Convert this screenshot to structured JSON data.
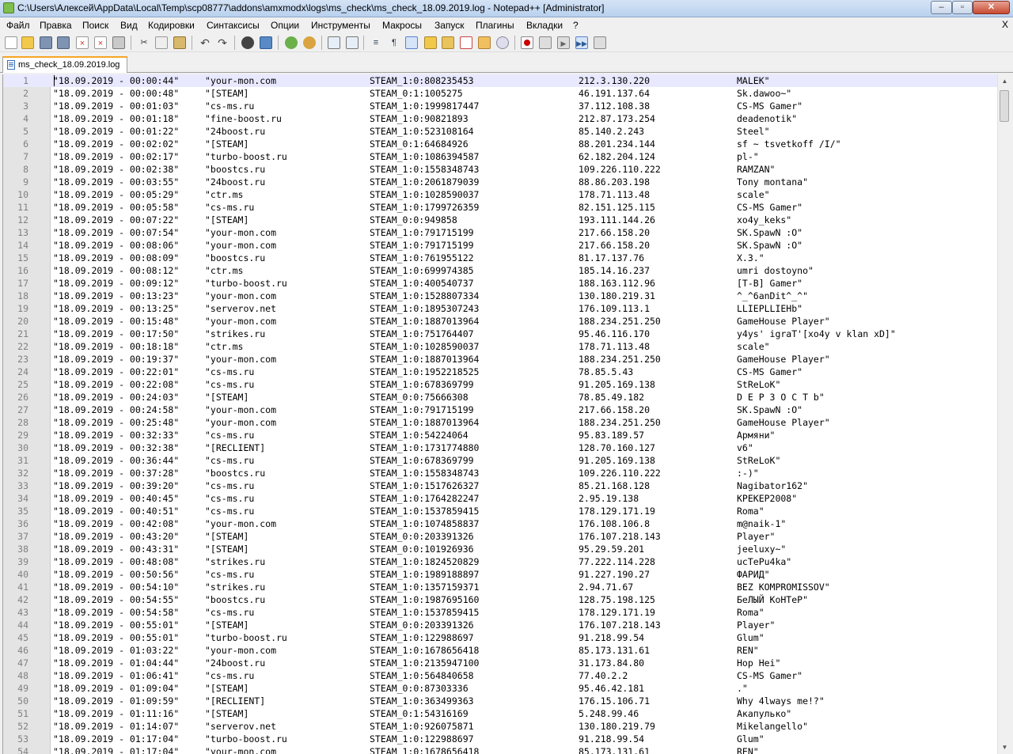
{
  "window": {
    "title": "C:\\Users\\Алексей\\AppData\\Local\\Temp\\scp08777\\addons\\amxmodx\\logs\\ms_check\\ms_check_18.09.2019.log - Notepad++ [Administrator]",
    "minimize_label": "–",
    "maximize_label": "▫",
    "close_label": "✕"
  },
  "menu": {
    "items": [
      "Файл",
      "Правка",
      "Поиск",
      "Вид",
      "Кодировки",
      "Синтаксисы",
      "Опции",
      "Инструменты",
      "Макросы",
      "Запуск",
      "Плагины",
      "Вкладки",
      "?"
    ],
    "close_doc_label": "X"
  },
  "toolbar": {
    "icons": [
      "new-file-icon",
      "open-file-icon",
      "save-icon",
      "save-all-icon",
      "close-icon",
      "close-all-icon",
      "print-icon",
      "cut-icon",
      "copy-icon",
      "paste-icon",
      "undo-icon",
      "redo-icon",
      "find-icon",
      "replace-icon",
      "zoom-in-icon",
      "zoom-out-icon",
      "sync-vertical-icon",
      "sync-horizontal-icon",
      "word-wrap-icon",
      "show-all-chars-icon",
      "indent-guide-icon",
      "doc-map-icon",
      "function-list-icon",
      "folder-as-workspace-icon",
      "monitoring-icon",
      "record-macro-icon",
      "stop-macro-icon",
      "play-macro-icon",
      "run-macro-multiple-icon",
      "save-macro-icon"
    ]
  },
  "tab": {
    "label": "ms_check_18.09.2019.log"
  },
  "editor": {
    "lines": [
      [
        "1",
        "\"18.09.2019 - 00:00:44\"",
        "\"your-mon.com",
        "STEAM_1:0:808235453",
        "212.3.130.220",
        "MALEK\""
      ],
      [
        "2",
        "\"18.09.2019 - 00:00:48\"",
        "\"[STEAM]",
        "STEAM_0:1:1005275",
        "46.191.137.64",
        "Sk.dawoo~\""
      ],
      [
        "3",
        "\"18.09.2019 - 00:01:03\"",
        "\"cs-ms.ru",
        "STEAM_1:0:1999817447",
        "37.112.108.38",
        "CS-MS Gamer\""
      ],
      [
        "4",
        "\"18.09.2019 - 00:01:18\"",
        "\"fine-boost.ru",
        "STEAM_1:0:90821893",
        "212.87.173.254",
        "deadenotik\""
      ],
      [
        "5",
        "\"18.09.2019 - 00:01:22\"",
        "\"24boost.ru",
        "STEAM_1:0:523108164",
        "85.140.2.243",
        "Steel\""
      ],
      [
        "6",
        "\"18.09.2019 - 00:02:02\"",
        "\"[STEAM]",
        "STEAM_0:1:64684926",
        "88.201.234.144",
        "sf ~ tsvetkoff /I/\""
      ],
      [
        "7",
        "\"18.09.2019 - 00:02:17\"",
        "\"turbo-boost.ru",
        "STEAM_1:0:1086394587",
        "62.182.204.124",
        "pl-\""
      ],
      [
        "8",
        "\"18.09.2019 - 00:02:38\"",
        "\"boostcs.ru",
        "STEAM_1:0:1558348743",
        "109.226.110.222",
        "RAMZAN\""
      ],
      [
        "9",
        "\"18.09.2019 - 00:03:55\"",
        "\"24boost.ru",
        "STEAM_1:0:2061879039",
        "88.86.203.198",
        "Tony montana\""
      ],
      [
        "10",
        "\"18.09.2019 - 00:05:29\"",
        "\"ctr.ms",
        "STEAM_1:0:1028590037",
        "178.71.113.48",
        "scale\""
      ],
      [
        "11",
        "\"18.09.2019 - 00:05:58\"",
        "\"cs-ms.ru",
        "STEAM_1:0:1799726359",
        "82.151.125.115",
        "CS-MS Gamer\""
      ],
      [
        "12",
        "\"18.09.2019 - 00:07:22\"",
        "\"[STEAM]",
        "STEAM_0:0:949858",
        "193.111.144.26",
        "xo4y_keks\""
      ],
      [
        "13",
        "\"18.09.2019 - 00:07:54\"",
        "\"your-mon.com",
        "STEAM_1:0:791715199",
        "217.66.158.20",
        "SK.SpawN :O\""
      ],
      [
        "14",
        "\"18.09.2019 - 00:08:06\"",
        "\"your-mon.com",
        "STEAM_1:0:791715199",
        "217.66.158.20",
        "SK.SpawN :O\""
      ],
      [
        "15",
        "\"18.09.2019 - 00:08:09\"",
        "\"boostcs.ru",
        "STEAM_1:0:761955122",
        "81.17.137.76",
        "X.3.\""
      ],
      [
        "16",
        "\"18.09.2019 - 00:08:12\"",
        "\"ctr.ms",
        "STEAM_1:0:699974385",
        "185.14.16.237",
        "umri dostoyno\""
      ],
      [
        "17",
        "\"18.09.2019 - 00:09:12\"",
        "\"turbo-boost.ru",
        "STEAM_1:0:400540737",
        "188.163.112.96",
        "[T-B] Gamer\""
      ],
      [
        "18",
        "\"18.09.2019 - 00:13:23\"",
        "\"your-mon.com",
        "STEAM_1:0:1528807334",
        "130.180.219.31",
        "^_^6anDit^_^\""
      ],
      [
        "19",
        "\"18.09.2019 - 00:13:25\"",
        "\"serverov.net",
        "STEAM_1:0:1895307243",
        "176.109.113.1",
        "LLIEPLLIEHb\""
      ],
      [
        "20",
        "\"18.09.2019 - 00:15:48\"",
        "\"your-mon.com",
        "STEAM_1:0:1887013964",
        "188.234.251.250",
        "GameHouse Player\""
      ],
      [
        "21",
        "\"18.09.2019 - 00:17:50\"",
        "\"strikes.ru",
        "STEAM_1:0:751764407",
        "95.46.116.170",
        "y4ys' igraT'[xo4y v klan xD]\""
      ],
      [
        "22",
        "\"18.09.2019 - 00:18:18\"",
        "\"ctr.ms",
        "STEAM_1:0:1028590037",
        "178.71.113.48",
        "scale\""
      ],
      [
        "23",
        "\"18.09.2019 - 00:19:37\"",
        "\"your-mon.com",
        "STEAM_1:0:1887013964",
        "188.234.251.250",
        "GameHouse Player\""
      ],
      [
        "24",
        "\"18.09.2019 - 00:22:01\"",
        "\"cs-ms.ru",
        "STEAM_1:0:1952218525",
        "78.85.5.43",
        "CS-MS Gamer\""
      ],
      [
        "25",
        "\"18.09.2019 - 00:22:08\"",
        "\"cs-ms.ru",
        "STEAM_1:0:678369799",
        "91.205.169.138",
        "StReLoK\""
      ],
      [
        "26",
        "\"18.09.2019 - 00:24:03\"",
        "\"[STEAM]",
        "STEAM_0:0:75666308",
        "78.85.49.182",
        "D E P 3 O C T b\""
      ],
      [
        "27",
        "\"18.09.2019 - 00:24:58\"",
        "\"your-mon.com",
        "STEAM_1:0:791715199",
        "217.66.158.20",
        "SK.SpawN :O\""
      ],
      [
        "28",
        "\"18.09.2019 - 00:25:48\"",
        "\"your-mon.com",
        "STEAM_1:0:1887013964",
        "188.234.251.250",
        "GameHouse Player\""
      ],
      [
        "29",
        "\"18.09.2019 - 00:32:33\"",
        "\"cs-ms.ru",
        "STEAM_1:0:54224064",
        "95.83.189.57",
        "Армяни\""
      ],
      [
        "30",
        "\"18.09.2019 - 00:32:38\"",
        "\"[RECLIENT]",
        "STEAM_1:0:1731774880",
        "128.70.160.127",
        "v6\""
      ],
      [
        "31",
        "\"18.09.2019 - 00:36:44\"",
        "\"cs-ms.ru",
        "STEAM_1:0:678369799",
        "91.205.169.138",
        "StReLoK\""
      ],
      [
        "32",
        "\"18.09.2019 - 00:37:28\"",
        "\"boostcs.ru",
        "STEAM_1:0:1558348743",
        "109.226.110.222",
        ":-)\""
      ],
      [
        "33",
        "\"18.09.2019 - 00:39:20\"",
        "\"cs-ms.ru",
        "STEAM_1:0:1517626327",
        "85.21.168.128",
        "Nagibator162\""
      ],
      [
        "34",
        "\"18.09.2019 - 00:40:45\"",
        "\"cs-ms.ru",
        "STEAM_1:0:1764282247",
        "2.95.19.138",
        "КРЕКЕР2008\""
      ],
      [
        "35",
        "\"18.09.2019 - 00:40:51\"",
        "\"cs-ms.ru",
        "STEAM_1:0:1537859415",
        "178.129.171.19",
        "Roma\""
      ],
      [
        "36",
        "\"18.09.2019 - 00:42:08\"",
        "\"your-mon.com",
        "STEAM_1:0:1074858837",
        "176.108.106.8",
        "m@naik-1\""
      ],
      [
        "37",
        "\"18.09.2019 - 00:43:20\"",
        "\"[STEAM]",
        "STEAM_0:0:203391326",
        "176.107.218.143",
        "Player\""
      ],
      [
        "38",
        "\"18.09.2019 - 00:43:31\"",
        "\"[STEAM]",
        "STEAM_0:0:101926936",
        "95.29.59.201",
        "jeeluxy~\""
      ],
      [
        "39",
        "\"18.09.2019 - 00:48:08\"",
        "\"strikes.ru",
        "STEAM_1:0:1824520829",
        "77.222.114.228",
        "ucTePu4ka\""
      ],
      [
        "40",
        "\"18.09.2019 - 00:50:56\"",
        "\"cs-ms.ru",
        "STEAM_1:0:1989188897",
        "91.227.190.27",
        "ФАРИД\""
      ],
      [
        "41",
        "\"18.09.2019 - 00:54:10\"",
        "\"strikes.ru",
        "STEAM_1:0:1357159371",
        "2.94.71.67",
        "BEZ KOMPROMISSOV\""
      ],
      [
        "42",
        "\"18.09.2019 - 00:54:55\"",
        "\"boostcs.ru",
        "STEAM_1:0:1987695160",
        "128.75.198.125",
        "БеЛЫЙ КоНТеР\""
      ],
      [
        "43",
        "\"18.09.2019 - 00:54:58\"",
        "\"cs-ms.ru",
        "STEAM_1:0:1537859415",
        "178.129.171.19",
        "Roma\""
      ],
      [
        "44",
        "\"18.09.2019 - 00:55:01\"",
        "\"[STEAM]",
        "STEAM_0:0:203391326",
        "176.107.218.143",
        "Player\""
      ],
      [
        "45",
        "\"18.09.2019 - 00:55:01\"",
        "\"turbo-boost.ru",
        "STEAM_1:0:122988697",
        "91.218.99.54",
        "Glum\""
      ],
      [
        "46",
        "\"18.09.2019 - 01:03:22\"",
        "\"your-mon.com",
        "STEAM_1:0:1678656418",
        "85.173.131.61",
        "REN\""
      ],
      [
        "47",
        "\"18.09.2019 - 01:04:44\"",
        "\"24boost.ru",
        "STEAM_1:0:2135947100",
        "31.173.84.80",
        "Hop Hei\""
      ],
      [
        "48",
        "\"18.09.2019 - 01:06:41\"",
        "\"cs-ms.ru",
        "STEAM_1:0:564840658",
        "77.40.2.2",
        "CS-MS Gamer\""
      ],
      [
        "49",
        "\"18.09.2019 - 01:09:04\"",
        "\"[STEAM]",
        "STEAM_0:0:87303336",
        "95.46.42.181",
        ".\""
      ],
      [
        "50",
        "\"18.09.2019 - 01:09:59\"",
        "\"[RECLIENT]",
        "STEAM_1:0:363499363",
        "176.15.106.71",
        "Why 4lways me!?\""
      ],
      [
        "51",
        "\"18.09.2019 - 01:11:16\"",
        "\"[STEAM]",
        "STEAM_0:1:54316169",
        "5.248.99.46",
        "Акапулько\""
      ],
      [
        "52",
        "\"18.09.2019 - 01:14:07\"",
        "\"serverov.net",
        "STEAM_1:0:926075871",
        "130.180.219.79",
        "Mikelangello\""
      ],
      [
        "53",
        "\"18.09.2019 - 01:17:04\"",
        "\"turbo-boost.ru",
        "STEAM_1:0:122988697",
        "91.218.99.54",
        "Glum\""
      ],
      [
        "54",
        "\"18.09.2019 - 01:17:04\"",
        "\"your-mon.com",
        "STEAM_1:0:1678656418",
        "85.173.131.61",
        "REN\""
      ]
    ]
  }
}
